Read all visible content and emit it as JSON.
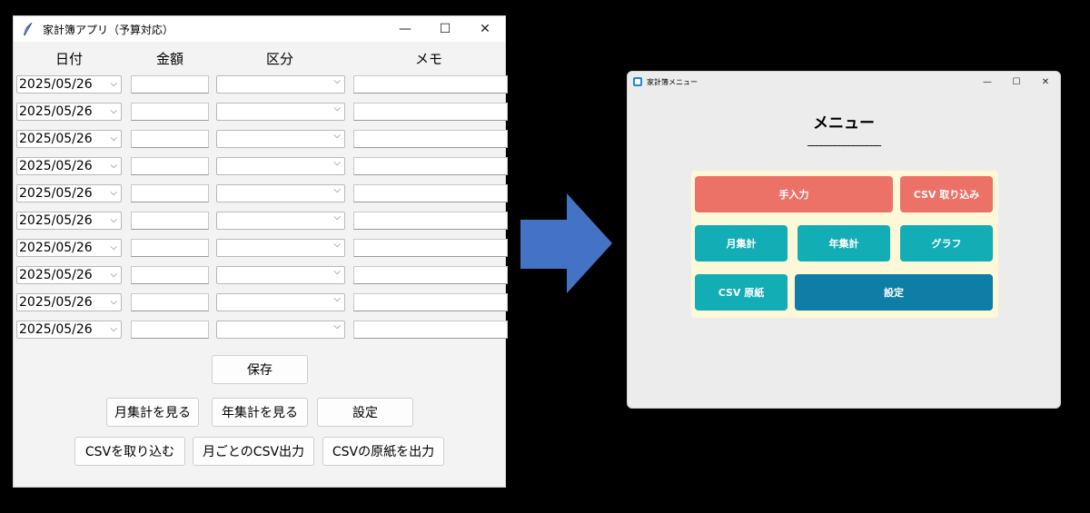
{
  "left_window": {
    "title": "家計簿アプリ（予算対応）",
    "controls": {
      "minimize": "—",
      "maximize": "☐",
      "close": "✕"
    },
    "headers": {
      "date": "日付",
      "amount": "金額",
      "category": "区分",
      "memo": "メモ"
    },
    "rows": [
      {
        "date": "2025/05/26"
      },
      {
        "date": "2025/05/26"
      },
      {
        "date": "2025/05/26"
      },
      {
        "date": "2025/05/26"
      },
      {
        "date": "2025/05/26"
      },
      {
        "date": "2025/05/26"
      },
      {
        "date": "2025/05/26"
      },
      {
        "date": "2025/05/26"
      },
      {
        "date": "2025/05/26"
      },
      {
        "date": "2025/05/26"
      }
    ],
    "buttons": {
      "save": "保存",
      "monthly": "月集計を見る",
      "yearly": "年集計を見る",
      "settings": "設定",
      "import_csv": "CSVを取り込む",
      "monthly_csv": "月ごとのCSV出力",
      "csv_template": "CSVの原紙を出力"
    }
  },
  "right_window": {
    "title": "家計簿メニュー",
    "controls": {
      "minimize": "—",
      "maximize": "☐",
      "close": "✕"
    },
    "heading": "メニュー",
    "underline": "________________",
    "buttons": {
      "manual": "手入力",
      "csv_import": "CSV 取り込み",
      "monthly": "月集計",
      "yearly": "年集計",
      "graph": "グラフ",
      "csv_template": "CSV 原紙",
      "settings": "設定"
    }
  },
  "colors": {
    "coral": "#ec7268",
    "teal": "#12adb5",
    "blue": "#0e7ea6",
    "arrow": "#4472c4",
    "panel": "#fdf8d8"
  },
  "icons": [
    "feather-icon",
    "app-icon",
    "chevron-down-icon",
    "right-arrow-icon"
  ]
}
